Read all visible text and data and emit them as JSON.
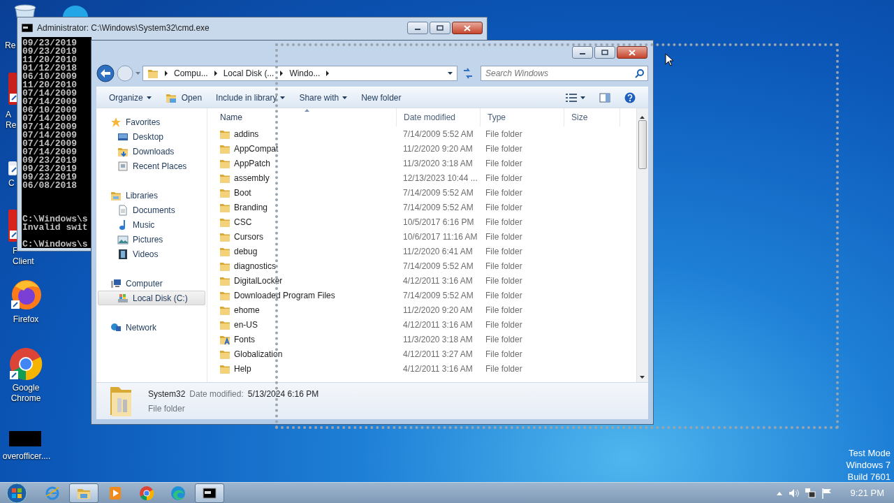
{
  "desktop_icons": [
    {
      "kind": "recycle",
      "label_lines": [
        "Re"
      ]
    },
    {
      "kind": "skype"
    },
    {
      "kind": "reader",
      "label_lines": [
        "A",
        "Re"
      ]
    },
    {
      "kind": "shortcut",
      "label_lines": [
        "C"
      ]
    },
    {
      "kind": "red-app",
      "label_lines": [
        "F",
        "Client"
      ]
    },
    {
      "kind": "firefox",
      "label_lines": [
        "Firefox"
      ]
    },
    {
      "kind": "chrome",
      "label_lines": [
        "Google",
        "Chrome"
      ]
    },
    {
      "kind": "blackfile",
      "label_lines": [
        "overofficer...."
      ]
    }
  ],
  "console_window": {
    "title": "Administrator: C:\\Windows\\System32\\cmd.exe",
    "blocks": [
      [
        "09/23/2019",
        "09/23/2019",
        "11/20/2010",
        "01/12/2018",
        "06/10/2009",
        "11/20/2010",
        "07/14/2009",
        "07/14/2009",
        "06/10/2009",
        "07/14/2009",
        "07/14/2009",
        "07/14/2009",
        "07/14/2009",
        "07/14/2009",
        "09/23/2019",
        "09/23/2019",
        "09/23/2019",
        "06/08/2018"
      ],
      [
        "C:\\Windows\\s",
        "Invalid swit"
      ],
      [
        "C:\\Windows\\s"
      ]
    ]
  },
  "explorer_window": {
    "breadcrumbs": [
      "Compu...",
      "Local Disk (...",
      "Windo..."
    ],
    "search": {
      "placeholder": "Search Windows"
    },
    "toolbar": [
      {
        "label": "Organize",
        "dropdown": true,
        "kind": "plain"
      },
      {
        "label": "Open",
        "dropdown": false,
        "kind": "open"
      },
      {
        "label": "Include in library",
        "dropdown": true,
        "kind": "plain"
      },
      {
        "label": "Share with",
        "dropdown": true,
        "kind": "plain"
      },
      {
        "label": "New folder",
        "dropdown": false,
        "kind": "plain"
      }
    ],
    "nav": [
      {
        "label": "Favorites",
        "kind": "star",
        "selected": false,
        "children": [
          {
            "label": "Desktop",
            "kind": "desktop",
            "selected": false
          },
          {
            "label": "Downloads",
            "kind": "downloads",
            "selected": false
          },
          {
            "label": "Recent Places",
            "kind": "recent",
            "selected": false
          }
        ]
      },
      {
        "label": "Libraries",
        "kind": "library",
        "selected": false,
        "children": [
          {
            "label": "Documents",
            "kind": "documents",
            "selected": false
          },
          {
            "label": "Music",
            "kind": "music",
            "selected": false
          },
          {
            "label": "Pictures",
            "kind": "pictures",
            "selected": false
          },
          {
            "label": "Videos",
            "kind": "videos",
            "selected": false
          }
        ]
      },
      {
        "label": "Computer",
        "kind": "computer",
        "selected": false,
        "children": [
          {
            "label": "Local Disk (C:)",
            "kind": "disk",
            "selected": true
          }
        ]
      },
      {
        "label": "Network",
        "kind": "network",
        "selected": false
      }
    ],
    "columns": [
      {
        "label": "Name",
        "sorted": true
      },
      {
        "label": "Date modified",
        "sorted": false
      },
      {
        "label": "Type",
        "sorted": false
      },
      {
        "label": "Size",
        "sorted": false
      }
    ],
    "files": [
      {
        "name": "addins",
        "kind": "folder",
        "date": "7/14/2009 5:52 AM",
        "type": "File folder",
        "selected": false
      },
      {
        "name": "AppCompat",
        "kind": "folder",
        "date": "11/2/2020 9:20 AM",
        "type": "File folder",
        "selected": false
      },
      {
        "name": "AppPatch",
        "kind": "folder",
        "date": "11/3/2020 3:18 AM",
        "type": "File folder",
        "selected": false
      },
      {
        "name": "assembly",
        "kind": "folder",
        "date": "12/13/2023 10:44 ...",
        "type": "File folder",
        "selected": false
      },
      {
        "name": "Boot",
        "kind": "folder",
        "date": "7/14/2009 5:52 AM",
        "type": "File folder",
        "selected": false
      },
      {
        "name": "Branding",
        "kind": "folder",
        "date": "7/14/2009 5:52 AM",
        "type": "File folder",
        "selected": false
      },
      {
        "name": "CSC",
        "kind": "folder",
        "date": "10/5/2017 6:16 PM",
        "type": "File folder",
        "selected": false
      },
      {
        "name": "Cursors",
        "kind": "folder",
        "date": "10/6/2017 11:16 AM",
        "type": "File folder",
        "selected": false
      },
      {
        "name": "debug",
        "kind": "folder",
        "date": "11/2/2020 6:41 AM",
        "type": "File folder",
        "selected": false
      },
      {
        "name": "diagnostics",
        "kind": "folder",
        "date": "7/14/2009 5:52 AM",
        "type": "File folder",
        "selected": false
      },
      {
        "name": "DigitalLocker",
        "kind": "folder",
        "date": "4/12/2011 3:16 AM",
        "type": "File folder",
        "selected": false
      },
      {
        "name": "Downloaded Program Files",
        "kind": "folder",
        "date": "7/14/2009 5:52 AM",
        "type": "File folder",
        "selected": false
      },
      {
        "name": "ehome",
        "kind": "folder",
        "date": "11/2/2020 9:20 AM",
        "type": "File folder",
        "selected": false
      },
      {
        "name": "en-US",
        "kind": "folder",
        "date": "4/12/2011 3:16 AM",
        "type": "File folder",
        "selected": false
      },
      {
        "name": "Fonts",
        "kind": "fonts",
        "date": "11/3/2020 3:18 AM",
        "type": "File folder",
        "selected": false
      },
      {
        "name": "Globalization",
        "kind": "folder",
        "date": "4/12/2011 3:27 AM",
        "type": "File folder",
        "selected": false
      },
      {
        "name": "Help",
        "kind": "folder",
        "date": "4/12/2011 3:16 AM",
        "type": "File folder",
        "selected": false
      }
    ],
    "details": {
      "name": "System32",
      "date_label": "Date modified:",
      "date": "5/13/2024 6:16 PM",
      "type": "File folder"
    }
  },
  "desktop_text": [
    "Test Mode",
    "Windows 7",
    "Build 7601"
  ],
  "taskbar": {
    "items": [
      {
        "kind": "ie",
        "active": false
      },
      {
        "kind": "explorer",
        "active": true
      },
      {
        "kind": "media",
        "active": false
      },
      {
        "kind": "chrome",
        "active": false
      },
      {
        "kind": "edge",
        "active": false
      },
      {
        "kind": "console",
        "active": true
      }
    ],
    "time": "9:21 PM"
  }
}
